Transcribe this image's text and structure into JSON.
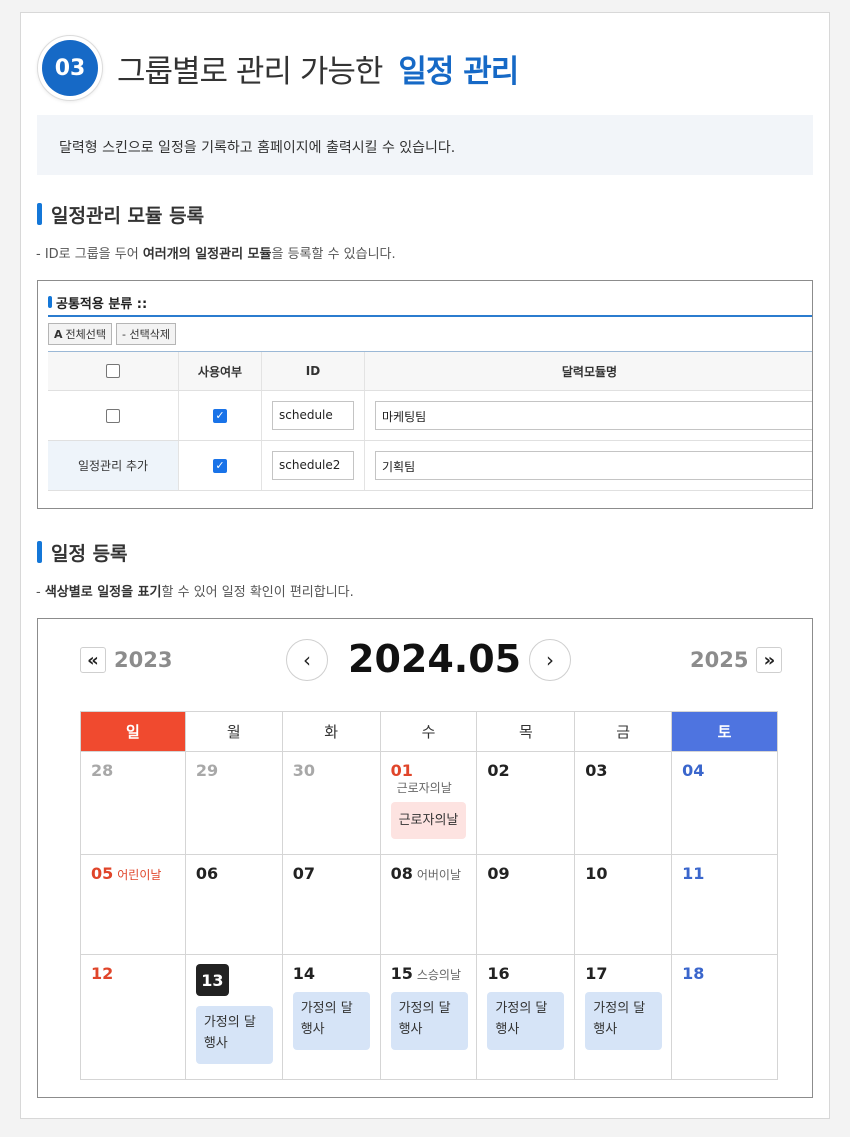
{
  "header": {
    "number": "03",
    "title": "그룹별로 관리 가능한",
    "title_accent": "일정 관리"
  },
  "intro": "달력형 스킨으로 일정을 기록하고 홈페이지에 출력시킬 수 있습니다.",
  "module_section": {
    "title": "일정관리 모듈 등록",
    "desc_prefix": "- ID로 그룹을 두어 ",
    "desc_bold": "여러개의 일정관리 모듈",
    "desc_suffix": "을 등록할 수 있습니다.",
    "panel_title": "공통적용 분류 ::",
    "btn_select_all": "전체선택",
    "btn_select_all_icon": "A",
    "btn_delete": "- 선택삭제",
    "columns": [
      "",
      "사용여부",
      "ID",
      "달력모듈명"
    ],
    "rows": [
      {
        "label": "",
        "use": true,
        "id": "schedule",
        "name": "마케팅팀"
      },
      {
        "label": "일정관리 추가",
        "use": true,
        "id": "schedule2",
        "name": "기획팀"
      }
    ]
  },
  "schedule_section": {
    "title": "일정 등록",
    "desc_prefix": "- ",
    "desc_bold": "색상별로 일정을 표기",
    "desc_suffix": "할 수 있어 일정 확인이 편리합니다."
  },
  "calendar": {
    "prev_year": "2023",
    "next_year": "2025",
    "current": "2024.05",
    "prev_year_icon": "«",
    "next_year_icon": "»",
    "prev_month_icon": "‹",
    "next_month_icon": "›",
    "weekdays": [
      "일",
      "월",
      "화",
      "수",
      "목",
      "금",
      "토"
    ],
    "week1": [
      "28",
      "29",
      "30",
      "01",
      "02",
      "03",
      "04"
    ],
    "week2": [
      "05",
      "06",
      "07",
      "08",
      "09",
      "10",
      "11"
    ],
    "week3": [
      "12",
      "13",
      "14",
      "15",
      "16",
      "17",
      "18"
    ],
    "holiday_0501": "근로자의날",
    "event_0501": "근로자의날",
    "holiday_0505": "어린이날",
    "holiday_0508": "어버이날",
    "holiday_0515": "스승의날",
    "event_family": "가정의 달 행사",
    "colors": {
      "sunday": "#f04a2f",
      "saturday": "#4e74e0",
      "accent": "#1669c6"
    }
  }
}
